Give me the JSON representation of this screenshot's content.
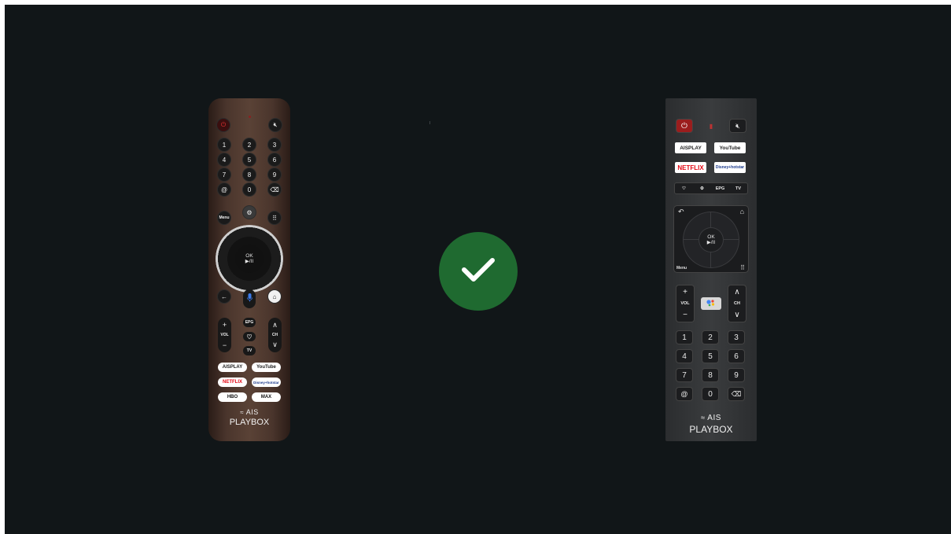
{
  "colors": {
    "background": "#111618",
    "check_badge": "#1f6a30",
    "power": "#e33333"
  },
  "status": {
    "icon": "checkmark-icon"
  },
  "remote_left": {
    "numpad": [
      "1",
      "2",
      "3",
      "4",
      "5",
      "6",
      "7",
      "8",
      "9",
      "@",
      "0"
    ],
    "menu_label": "Menu",
    "ok_label": "OK",
    "play_pause": "▶/II",
    "vol_label": "VOL",
    "ch_label": "CH",
    "epg_label": "EPG",
    "tv_label": "TV",
    "apps": [
      "AISPLAY",
      "YouTube",
      "NETFLIX",
      "Disney+hotstar",
      "HBO",
      "MAX"
    ],
    "brand_top": "AIS",
    "brand_bottom": "PLAYBOX"
  },
  "remote_right": {
    "apps": [
      "AISPLAY",
      "YouTube",
      "NETFLIX",
      "Disney+hotstar"
    ],
    "epg_label": "EPG",
    "tv_label": "TV",
    "ok_label": "OK",
    "play_pause": "▶/II",
    "menu_label": "Menu",
    "vol_label": "VOL",
    "ch_label": "CH",
    "numpad": [
      "1",
      "2",
      "3",
      "4",
      "5",
      "6",
      "7",
      "8",
      "9",
      "@",
      "0"
    ],
    "brand_top": "AIS",
    "brand_bottom": "PLAYBOX"
  }
}
